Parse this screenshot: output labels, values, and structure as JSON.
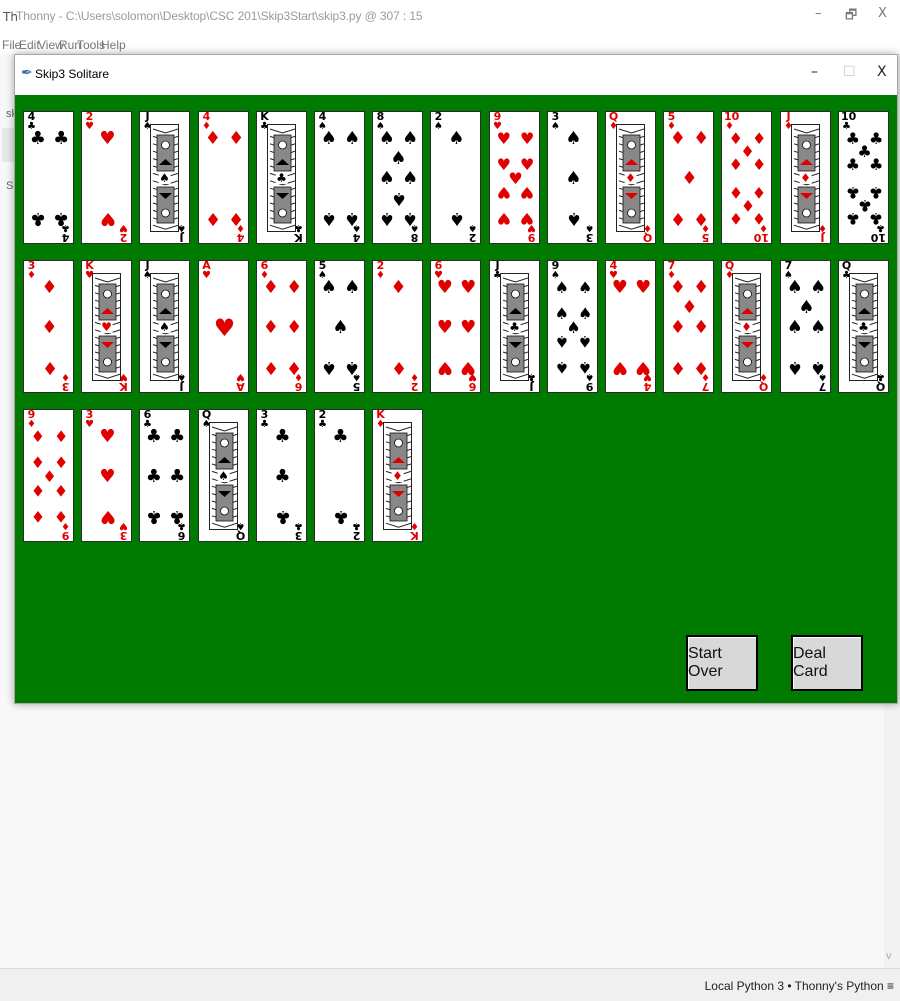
{
  "thonny": {
    "logo": "Th",
    "title": "Thonny  -  C:\\Users\\solomon\\Desktop\\CSC 201\\Skip3Start\\skip3.py  @  307 : 15",
    "controls": {
      "minimize": "–",
      "restore": "🗗",
      "close": "X"
    },
    "menu": [
      "File",
      "Edit",
      "View",
      "Run",
      "Tools",
      "Help"
    ],
    "left_fragment_1": "sk",
    "left_fragment_2": "Sh",
    "status": "Local Python 3  •  Thonny's Python  ≡",
    "scroll_down": "v"
  },
  "skip3": {
    "title": "Skip3 Solitare",
    "controls": {
      "minimize": "–",
      "maximize": "☐",
      "close": "X"
    },
    "buttons": {
      "start_over": "Start Over",
      "deal_card": "Deal Card"
    },
    "colors": {
      "felt": "#007a00",
      "red": "#e00000",
      "black": "#000000"
    },
    "rows": [
      [
        "4♣",
        "2♥",
        "J♠",
        "4♦",
        "K♣",
        "4♠",
        "8♠",
        "2♠",
        "9♥",
        "3♠",
        "Q♦",
        "5♦",
        "10♦",
        "J♦",
        "10♣"
      ],
      [
        "3♦",
        "K♥",
        "J♠",
        "A♥",
        "6♦",
        "5♠",
        "2♦",
        "6♥",
        "J♣",
        "9♠",
        "4♥",
        "7♦",
        "Q♦",
        "7♠",
        "Q♣"
      ],
      [
        "9♦",
        "3♥",
        "6♣",
        "Q♠",
        "3♣",
        "2♣",
        "K♦"
      ]
    ]
  }
}
